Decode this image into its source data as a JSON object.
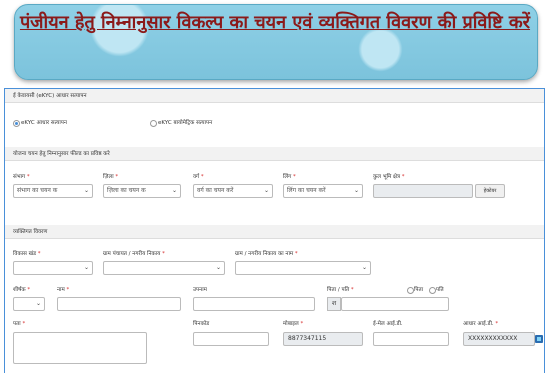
{
  "banner": {
    "title": "पंजीयन हेतु निम्नानुसार विकल्प का चयन एवं व्यक्तिगत विवरण की प्रविष्टि करें"
  },
  "ekyc": {
    "header": "ई केवायसी (eKYC) आधार सत्यापन",
    "option1": "eKYC आधार सत्यापन",
    "option2": "eKYC बायोमेट्रिक सत्यापन"
  },
  "scheme": {
    "header": "योजना चयन हेतु निम्नानुसार फील्ड का प्रविष्ठ करे",
    "sambhag_label": "संभाग",
    "sambhag_value": "संभाग का चयन क",
    "jila_label": "ज़िला",
    "jila_value": "ज़िला का चयन क",
    "varg_label": "वर्ग",
    "varg_value": "वर्ग का चयन करें",
    "ling_label": "लिंग",
    "ling_value": "लिंग का चयन करें",
    "land_label": "कुल भूमि क्षेत्र",
    "land_unit": "हेक्टेयर"
  },
  "personal": {
    "header": "व्यक्तिगत विवरण",
    "block_label": "विकास खंड",
    "gram_label": "ग्राम पंचायत / नगरीय निकाय",
    "gram_name_label": "ग्राम / नगरीय निकाय का नाम",
    "title_label": "शीर्षक",
    "name_label": "नाम",
    "upnaam_label": "उपनाम",
    "father_label": "पिता / पति",
    "father_prefix": "श",
    "father_opt": "पिता",
    "husband_opt": "पति",
    "address_label": "पता",
    "pincode_label": "पिनकोड",
    "mobile_label": "मोबाइल",
    "mobile_value": "8877347115",
    "email_label": "ई-मेल आई.डी.",
    "aadhaar_label": "आधार आई.डी.",
    "aadhaar_value": "XXXXXXXXXXXX"
  },
  "required_mark": "*"
}
